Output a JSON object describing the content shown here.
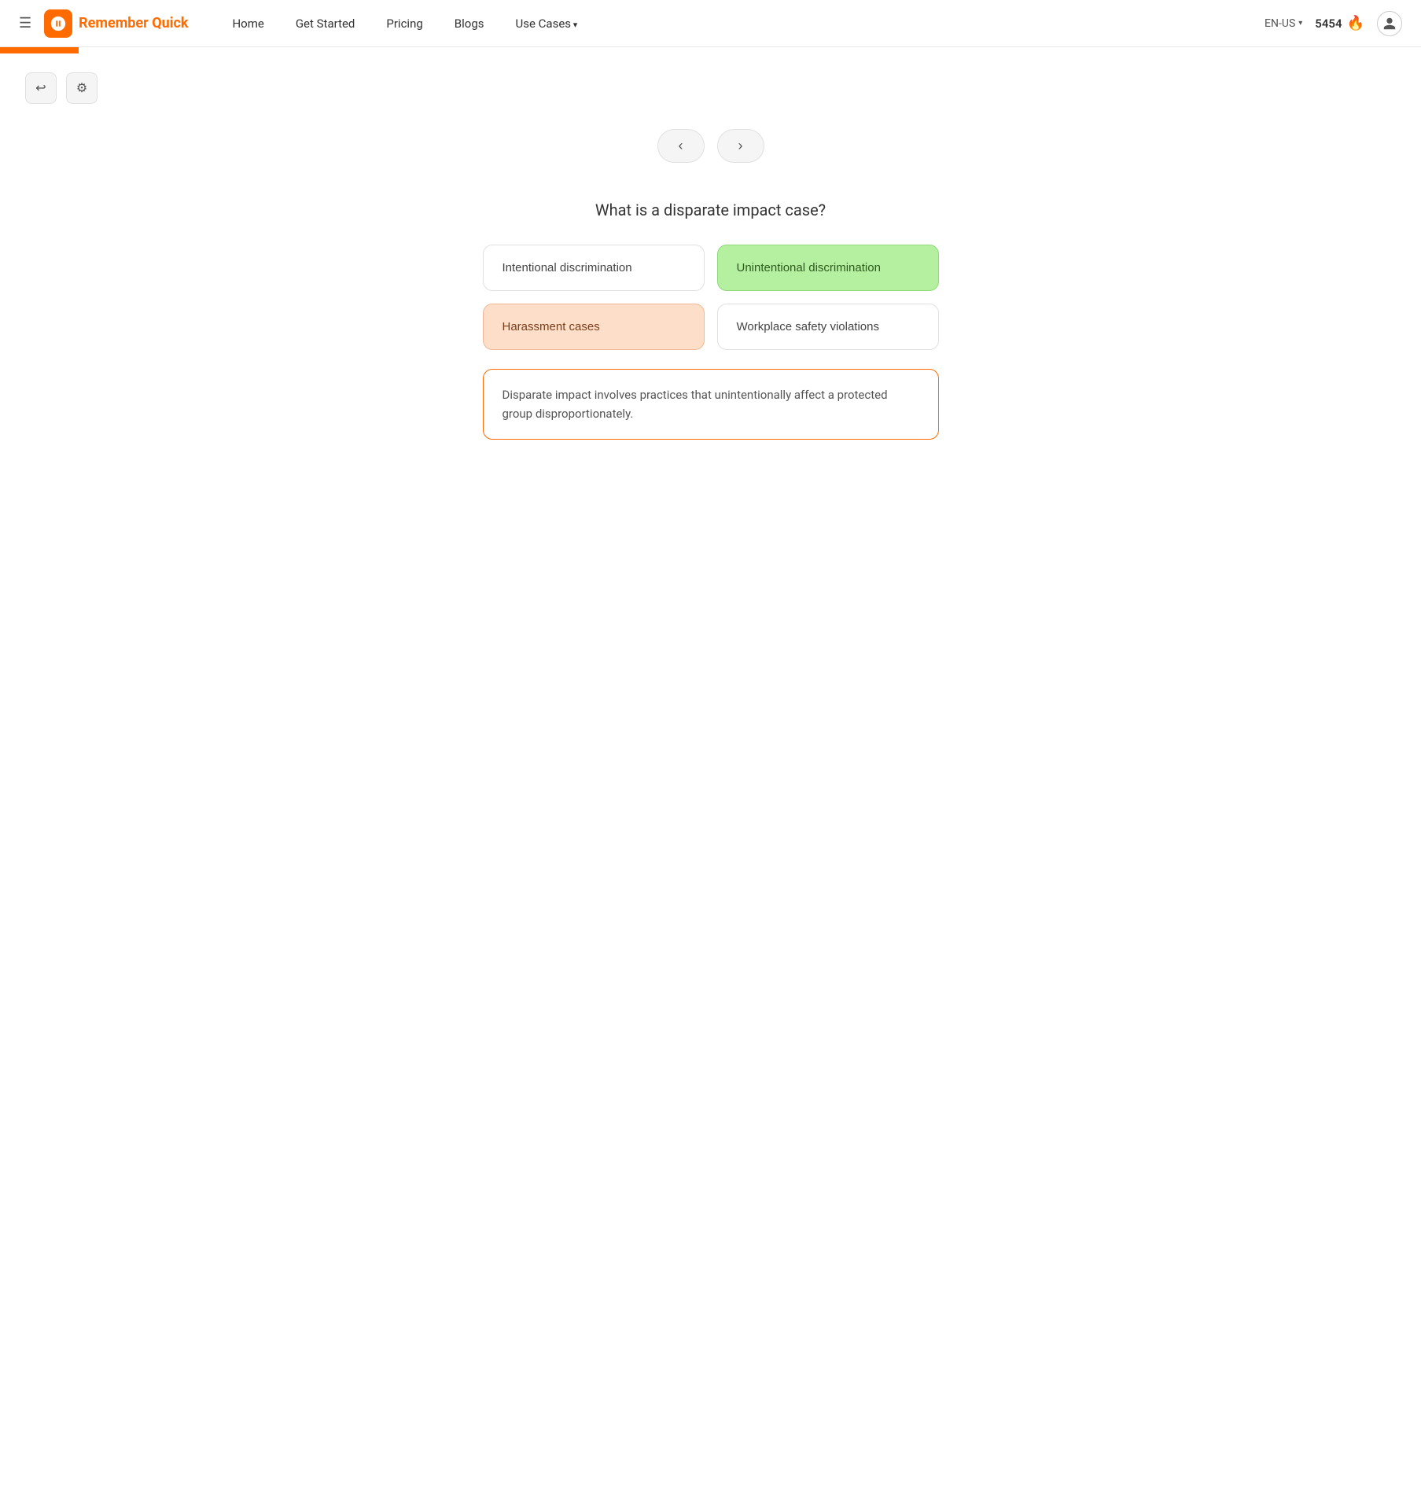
{
  "navbar": {
    "logo_text": "Remember Quick",
    "links": [
      {
        "label": "Home",
        "arrow": false
      },
      {
        "label": "Get Started",
        "arrow": false
      },
      {
        "label": "Pricing",
        "arrow": false
      },
      {
        "label": "Blogs",
        "arrow": false
      },
      {
        "label": "Use Cases",
        "arrow": true
      }
    ],
    "language": "EN-US",
    "credits": "5454",
    "credits_icon": "🔥"
  },
  "toolbar": {
    "back_icon": "↩",
    "settings_icon": "⚙"
  },
  "navigation": {
    "prev_icon": "‹",
    "next_icon": "›"
  },
  "quiz": {
    "question": "What is a disparate impact case?",
    "options": [
      {
        "label": "Intentional discrimination",
        "state": "neutral"
      },
      {
        "label": "Unintentional discrimination",
        "state": "correct"
      },
      {
        "label": "Harassment cases",
        "state": "incorrect"
      },
      {
        "label": "Workplace safety violations",
        "state": "neutral"
      }
    ],
    "explanation": "Disparate impact involves practices that unintentionally affect a protected group disproportionately."
  }
}
